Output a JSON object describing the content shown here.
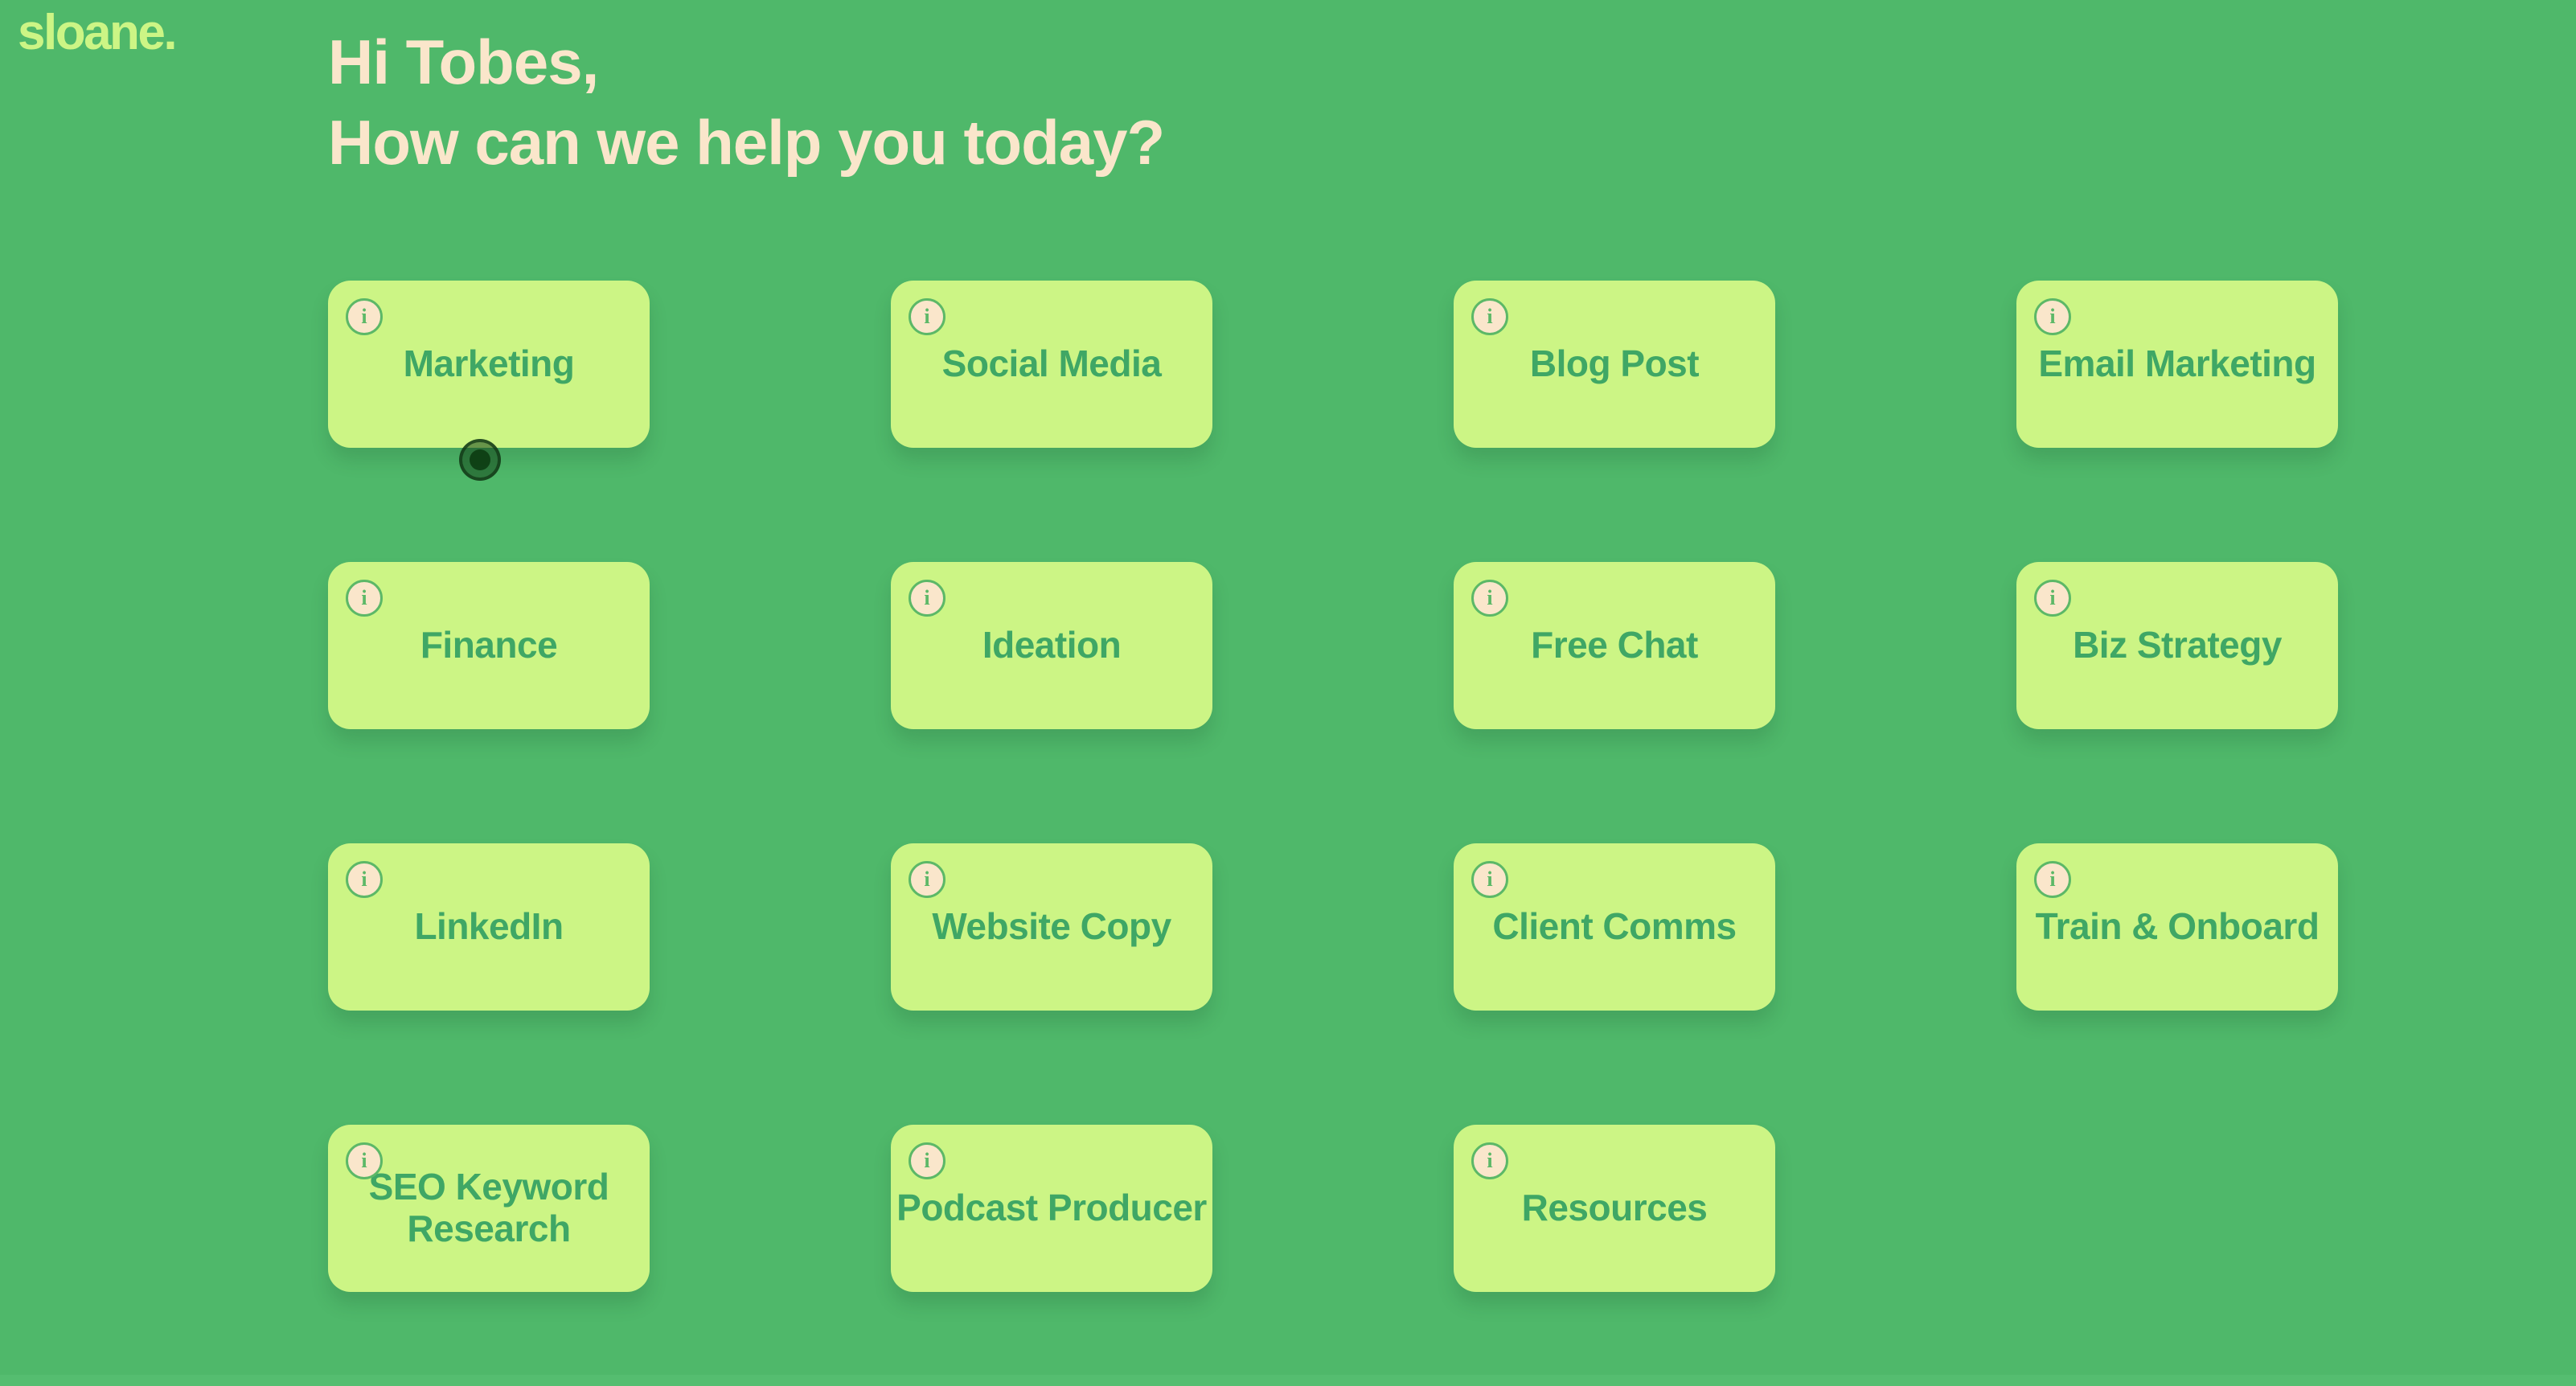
{
  "app": {
    "logo": "sloane.",
    "background_color": "#4fb86a",
    "card_color": "#ccf585",
    "card_text_color": "#3fa765",
    "heading_color": "#fae6cb",
    "info_icon_color": "#fae6cb"
  },
  "heading": {
    "line1": "Hi Tobes,",
    "line2": "How can we help you today?"
  },
  "info_icon": {
    "glyph": "i",
    "name": "info-icon"
  },
  "cards": [
    {
      "label": "Marketing",
      "wrap": false,
      "selected": true
    },
    {
      "label": "Social Media",
      "wrap": false,
      "selected": false
    },
    {
      "label": "Blog Post",
      "wrap": false,
      "selected": false
    },
    {
      "label": "Email Marketing",
      "wrap": true,
      "selected": false
    },
    {
      "label": "Finance",
      "wrap": false,
      "selected": false
    },
    {
      "label": "Ideation",
      "wrap": false,
      "selected": false
    },
    {
      "label": "Free Chat",
      "wrap": false,
      "selected": false
    },
    {
      "label": "Biz Strategy",
      "wrap": false,
      "selected": false
    },
    {
      "label": "LinkedIn",
      "wrap": false,
      "selected": false
    },
    {
      "label": "Website Copy",
      "wrap": false,
      "selected": false
    },
    {
      "label": "Client Comms",
      "wrap": false,
      "selected": false
    },
    {
      "label": "Train & Onboard",
      "wrap": true,
      "selected": false
    },
    {
      "label": "SEO Keyword Research",
      "wrap": true,
      "selected": false
    },
    {
      "label": "Podcast Producer",
      "wrap": true,
      "selected": false
    },
    {
      "label": "Resources",
      "wrap": false,
      "selected": false
    }
  ],
  "cursor": {
    "name": "click-indicator",
    "on_card": "Marketing"
  }
}
